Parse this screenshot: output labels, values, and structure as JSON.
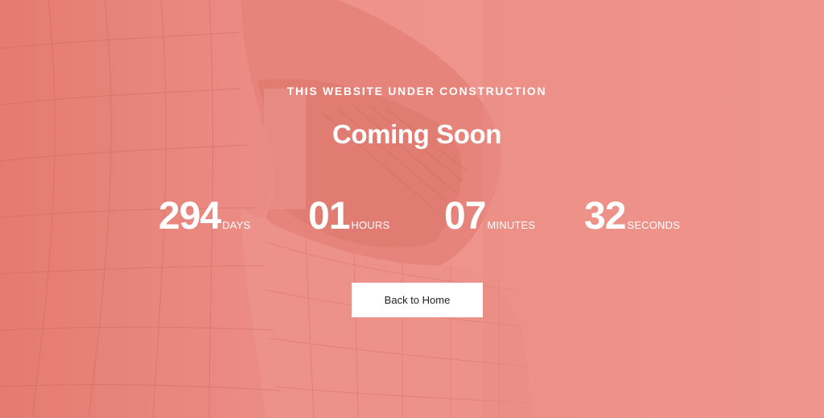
{
  "hero": {
    "eyebrow": "THIS WEBSITE UNDER CONSTRUCTION",
    "title": "Coming Soon"
  },
  "countdown": [
    {
      "value": "294",
      "label": "DAYS"
    },
    {
      "value": "01",
      "label": "HOURS"
    },
    {
      "value": "07",
      "label": "MINUTES"
    },
    {
      "value": "32",
      "label": "SECONDS"
    }
  ],
  "actions": {
    "back_home_label": "Back to Home"
  },
  "colors": {
    "background": "#ee938b",
    "text": "#ffffff",
    "button_bg": "#ffffff",
    "button_text": "#222222"
  }
}
